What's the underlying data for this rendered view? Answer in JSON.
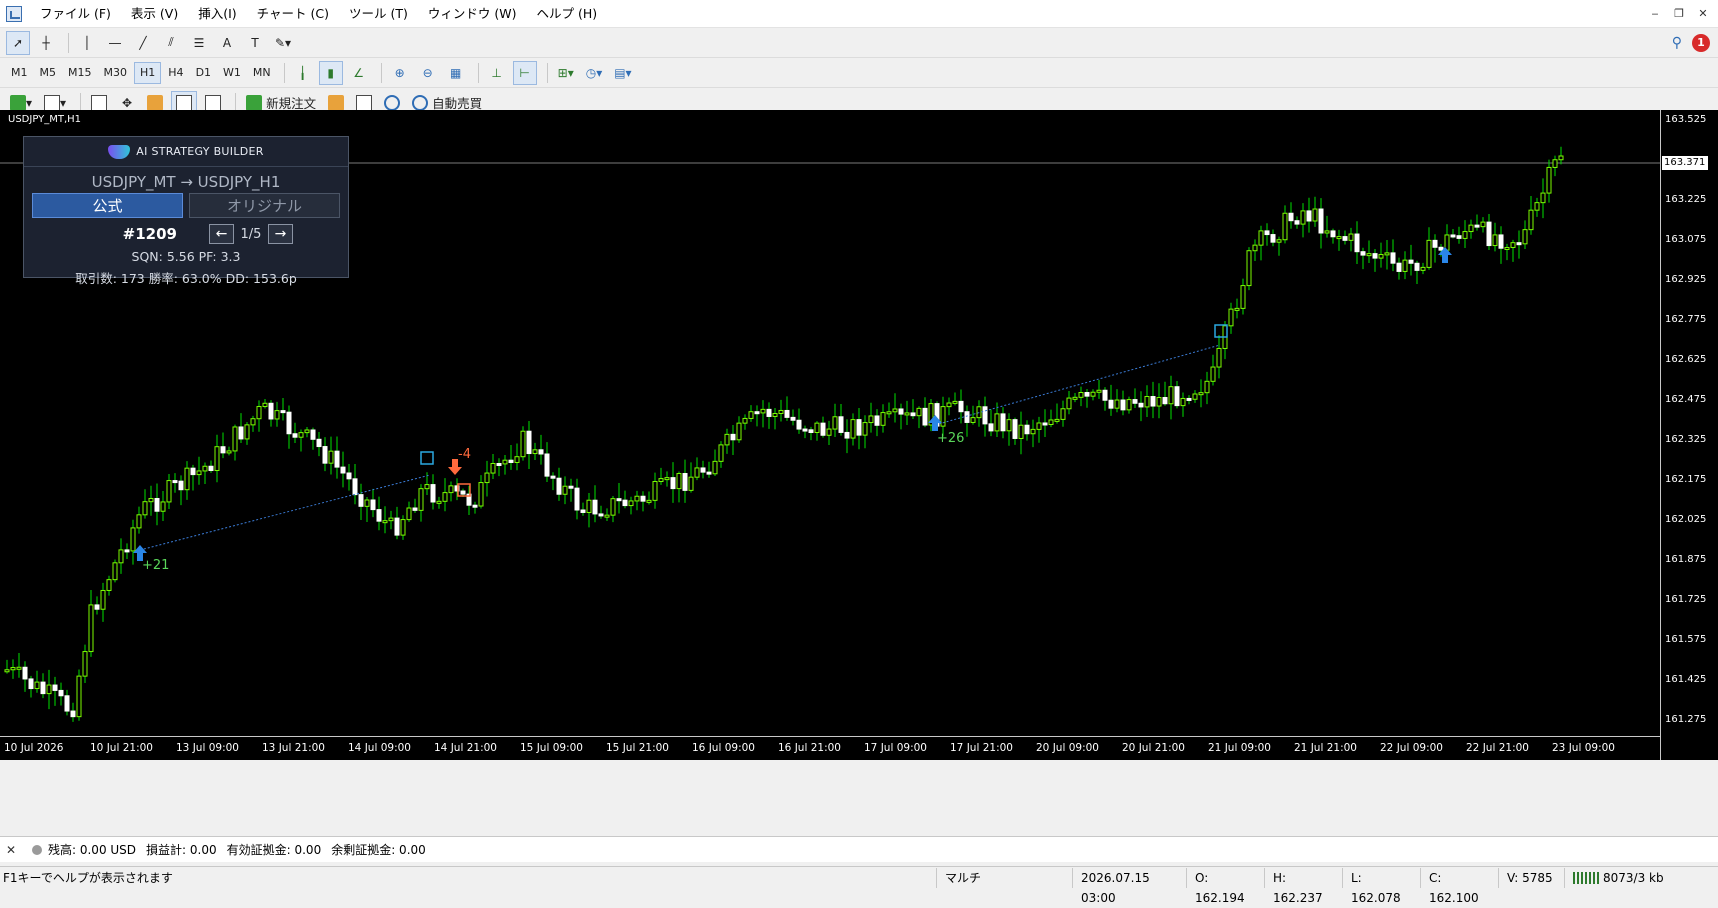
{
  "menu": [
    "ファイル (F)",
    "表示 (V)",
    "挿入(I)",
    "チャート (C)",
    "ツール (T)",
    "ウィンドウ (W)",
    "ヘルプ (H)"
  ],
  "window_controls": [
    "minimize",
    "restore",
    "close"
  ],
  "toolbar_top": {
    "tools": [
      "cursor-icon",
      "crosshair-icon",
      "vertical-line-icon",
      "horizontal-line-icon",
      "trendline-icon",
      "channel-icon",
      "fibonacci-icon",
      "text-icon",
      "text-label-icon",
      "shapes-icon"
    ],
    "notification_count": "1"
  },
  "timeframes": [
    "M1",
    "M5",
    "M15",
    "M30",
    "H1",
    "H4",
    "D1",
    "W1",
    "MN"
  ],
  "active_timeframe": "H1",
  "toolbar_bottom": {
    "new_order_label": "新規注文",
    "auto_trading_label": "自動売買"
  },
  "chart": {
    "title": "USDJPY_MT,H1",
    "current_price": "163.371",
    "price_labels": [
      "163.525",
      "163.225",
      "163.075",
      "162.925",
      "162.775",
      "162.625",
      "162.475",
      "162.325",
      "162.175",
      "162.025",
      "161.875",
      "161.725",
      "161.575",
      "161.425",
      "161.275"
    ],
    "time_labels": [
      "10 Jul 2026",
      "10 Jul 21:00",
      "13 Jul 09:00",
      "13 Jul 21:00",
      "14 Jul 09:00",
      "14 Jul 21:00",
      "15 Jul 09:00",
      "15 Jul 21:00",
      "16 Jul 09:00",
      "16 Jul 21:00",
      "17 Jul 09:00",
      "17 Jul 21:00",
      "20 Jul 09:00",
      "20 Jul 21:00",
      "21 Jul 09:00",
      "21 Jul 21:00",
      "22 Jul 09:00",
      "22 Jul 21:00",
      "23 Jul 09:00"
    ],
    "trade_labels": [
      "+21",
      "-4",
      "+26"
    ],
    "colors": {
      "bull": "#7CFC00",
      "bear": "#ffffff",
      "wick": "#00e000",
      "buy_arrow": "#2a86e8",
      "sell_arrow": "#ff6a3d",
      "trade_line": "#3a7bd5"
    }
  },
  "panel": {
    "brand": "AI STRATEGY BUILDER",
    "pair": "USDJPY_MT → USDJPY_H1",
    "tab_official": "公式",
    "tab_original": "オリジナル",
    "strategy_id": "#1209",
    "prev": "←",
    "page": "1/5",
    "next": "→",
    "stats_line1": "SQN: 5.56  PF: 3.3",
    "stats_line2": "取引数: 173  勝率: 63.0%  DD: 153.6p"
  },
  "terminal": {
    "balance": "残高: 0.00 USD",
    "profit": "損益計: 0.00",
    "equity": "有効証拠金: 0.00",
    "free_margin": "余剰証拠金: 0.00"
  },
  "status": {
    "help": "F1キーでヘルプが表示されます",
    "profile": "マルチ",
    "datetime": "2026.07.15 03:00",
    "open": "O: 162.194",
    "high": "H: 162.237",
    "low": "L: 162.078",
    "close": "C: 162.100",
    "volume": "V: 5785",
    "traffic": "8073/3 kb"
  }
}
